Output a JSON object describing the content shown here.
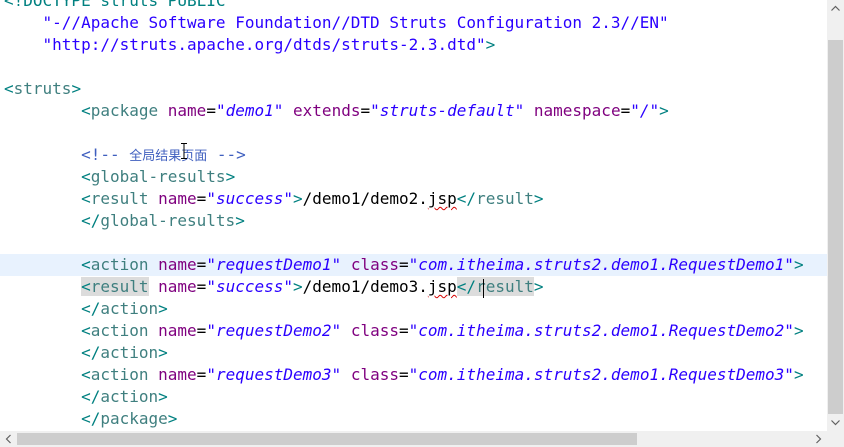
{
  "editor": {
    "language": "xml",
    "current_line_index": 12,
    "lines": [
      [
        {
          "t": "<!DOCTYPE ",
          "c": "bracket"
        },
        {
          "t": "struts ",
          "c": "bracket"
        },
        {
          "t": "PUBLIC",
          "c": "bracket"
        }
      ],
      [
        {
          "t": "    ",
          "c": "text"
        },
        {
          "t": "\"-//Apache Software Foundation//DTD Struts Configuration 2.3//EN\"",
          "c": "plainvalue"
        }
      ],
      [
        {
          "t": "    ",
          "c": "text"
        },
        {
          "t": "\"http://struts.apache.org/dtds/struts-2.3.dtd\"",
          "c": "plainvalue"
        },
        {
          "t": ">",
          "c": "bracket"
        }
      ],
      [],
      [
        {
          "t": "<",
          "c": "bracket"
        },
        {
          "t": "struts",
          "c": "tag"
        },
        {
          "t": ">",
          "c": "bracket"
        }
      ],
      [
        {
          "t": "        ",
          "c": "text"
        },
        {
          "t": "<",
          "c": "bracket"
        },
        {
          "t": "package",
          "c": "tag"
        },
        {
          "t": " ",
          "c": "text"
        },
        {
          "t": "name",
          "c": "attr"
        },
        {
          "t": "=",
          "c": "text"
        },
        {
          "t": "\"demo1\"",
          "c": "value"
        },
        {
          "t": " ",
          "c": "text"
        },
        {
          "t": "extends",
          "c": "attr"
        },
        {
          "t": "=",
          "c": "text"
        },
        {
          "t": "\"struts-default\"",
          "c": "value"
        },
        {
          "t": " ",
          "c": "text"
        },
        {
          "t": "namespace",
          "c": "attr"
        },
        {
          "t": "=",
          "c": "text"
        },
        {
          "t": "\"/\"",
          "c": "value"
        },
        {
          "t": ">",
          "c": "bracket"
        }
      ],
      [],
      [
        {
          "t": "        ",
          "c": "text"
        },
        {
          "t": "<!-- ",
          "c": "comment"
        },
        {
          "t": "全局结果页面",
          "c": "comment cjk"
        },
        {
          "t": " -->",
          "c": "comment"
        }
      ],
      [
        {
          "t": "        ",
          "c": "text"
        },
        {
          "t": "<",
          "c": "bracket"
        },
        {
          "t": "global-results",
          "c": "tag"
        },
        {
          "t": ">",
          "c": "bracket"
        }
      ],
      [
        {
          "t": "        ",
          "c": "text"
        },
        {
          "t": "<",
          "c": "bracket"
        },
        {
          "t": "result",
          "c": "tag"
        },
        {
          "t": " ",
          "c": "text"
        },
        {
          "t": "name",
          "c": "attr"
        },
        {
          "t": "=",
          "c": "text"
        },
        {
          "t": "\"success\"",
          "c": "value"
        },
        {
          "t": ">",
          "c": "bracket"
        },
        {
          "t": "/demo1/demo2.",
          "c": "text"
        },
        {
          "t": "jsp",
          "c": "text spell"
        },
        {
          "t": "</",
          "c": "bracket"
        },
        {
          "t": "result",
          "c": "tag"
        },
        {
          "t": ">",
          "c": "bracket"
        }
      ],
      [
        {
          "t": "        ",
          "c": "text"
        },
        {
          "t": "</",
          "c": "bracket"
        },
        {
          "t": "global-results",
          "c": "tag"
        },
        {
          "t": ">",
          "c": "bracket"
        }
      ],
      [],
      [
        {
          "t": "        ",
          "c": "text"
        },
        {
          "t": "<",
          "c": "bracket"
        },
        {
          "t": "action",
          "c": "tag"
        },
        {
          "t": " ",
          "c": "text"
        },
        {
          "t": "name",
          "c": "attr"
        },
        {
          "t": "=",
          "c": "text"
        },
        {
          "t": "\"requestDemo1\"",
          "c": "value"
        },
        {
          "t": " ",
          "c": "text"
        },
        {
          "t": "class",
          "c": "attr"
        },
        {
          "t": "=",
          "c": "text"
        },
        {
          "t": "\"com.itheima.struts2.demo1.RequestDemo1\"",
          "c": "value"
        },
        {
          "t": ">",
          "c": "bracket"
        }
      ],
      [
        {
          "t": "        ",
          "c": "text"
        },
        {
          "t": "<",
          "c": "bracket matched"
        },
        {
          "t": "result",
          "c": "tag matched"
        },
        {
          "t": " ",
          "c": "text"
        },
        {
          "t": "name",
          "c": "attr"
        },
        {
          "t": "=",
          "c": "text"
        },
        {
          "t": "\"success\"",
          "c": "value"
        },
        {
          "t": ">",
          "c": "bracket"
        },
        {
          "t": "/demo1/demo3.",
          "c": "text"
        },
        {
          "t": "jsp",
          "c": "text spell"
        },
        {
          "t": "</",
          "c": "bracket matched"
        },
        {
          "t": "result",
          "c": "tag matched"
        },
        {
          "t": ">",
          "c": "bracket"
        }
      ],
      [
        {
          "t": "        ",
          "c": "text"
        },
        {
          "t": "</",
          "c": "bracket"
        },
        {
          "t": "action",
          "c": "tag"
        },
        {
          "t": ">",
          "c": "bracket"
        }
      ],
      [
        {
          "t": "        ",
          "c": "text"
        },
        {
          "t": "<",
          "c": "bracket"
        },
        {
          "t": "action",
          "c": "tag"
        },
        {
          "t": " ",
          "c": "text"
        },
        {
          "t": "name",
          "c": "attr"
        },
        {
          "t": "=",
          "c": "text"
        },
        {
          "t": "\"requestDemo2\"",
          "c": "value"
        },
        {
          "t": " ",
          "c": "text"
        },
        {
          "t": "class",
          "c": "attr"
        },
        {
          "t": "=",
          "c": "text"
        },
        {
          "t": "\"com.itheima.struts2.demo1.RequestDemo2\"",
          "c": "value"
        },
        {
          "t": ">",
          "c": "bracket"
        }
      ],
      [
        {
          "t": "        ",
          "c": "text"
        },
        {
          "t": "</",
          "c": "bracket"
        },
        {
          "t": "action",
          "c": "tag"
        },
        {
          "t": ">",
          "c": "bracket"
        }
      ],
      [
        {
          "t": "        ",
          "c": "text"
        },
        {
          "t": "<",
          "c": "bracket"
        },
        {
          "t": "action",
          "c": "tag"
        },
        {
          "t": " ",
          "c": "text"
        },
        {
          "t": "name",
          "c": "attr"
        },
        {
          "t": "=",
          "c": "text"
        },
        {
          "t": "\"requestDemo3\"",
          "c": "value"
        },
        {
          "t": " ",
          "c": "text"
        },
        {
          "t": "class",
          "c": "attr"
        },
        {
          "t": "=",
          "c": "text"
        },
        {
          "t": "\"com.itheima.struts2.demo1.RequestDemo3\"",
          "c": "value"
        },
        {
          "t": ">",
          "c": "bracket"
        }
      ],
      [
        {
          "t": "        ",
          "c": "text"
        },
        {
          "t": "</",
          "c": "bracket"
        },
        {
          "t": "action",
          "c": "tag"
        },
        {
          "t": ">",
          "c": "bracket"
        }
      ],
      [
        {
          "t": "        ",
          "c": "text"
        },
        {
          "t": "</",
          "c": "bracket"
        },
        {
          "t": "package",
          "c": "tag"
        },
        {
          "t": ">",
          "c": "bracket"
        }
      ]
    ]
  },
  "scrollbars": {
    "vertical_icons": [
      "arrow-up-icon",
      "arrow-down-icon"
    ],
    "horizontal_icons": [
      "arrow-left-icon",
      "arrow-right-icon"
    ]
  },
  "colors": {
    "tag": "#3f7f7f",
    "bracket": "#008080",
    "attribute": "#7f007f",
    "attribute_value": "#2a00ff",
    "comment": "#3f5fbf",
    "current_line": "#e8f2fe",
    "matched_tag_highlight": "#dcdcdc",
    "scrollbar_track": "#f0f0f0",
    "scrollbar_thumb": "#cdcdcd"
  }
}
